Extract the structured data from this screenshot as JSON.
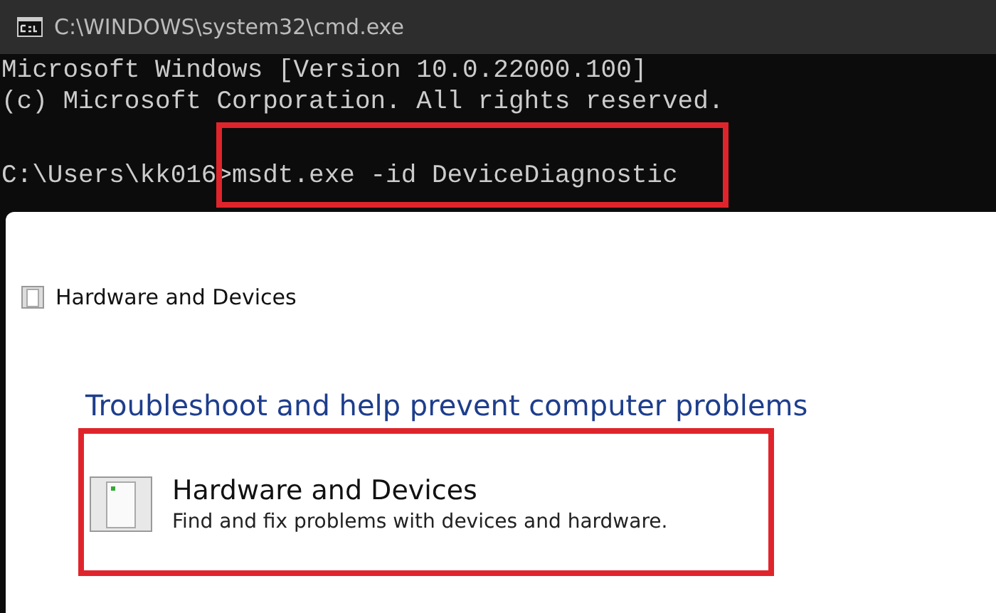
{
  "window": {
    "title": "C:\\WINDOWS\\system32\\cmd.exe"
  },
  "console": {
    "lines": [
      "Microsoft Windows [Version 10.0.22000.100]",
      "(c) Microsoft Corporation. All rights reserved."
    ],
    "prompt": "C:\\Users\\kk016>",
    "command": "msdt.exe -id DeviceDiagnostic",
    "command_highlighted": true
  },
  "dialog": {
    "title": "Hardware and Devices",
    "heading": "Troubleshoot and help prevent computer problems",
    "items": [
      {
        "title": "Hardware and Devices",
        "description": "Find and fix problems with devices and hardware.",
        "highlighted": true
      }
    ]
  }
}
